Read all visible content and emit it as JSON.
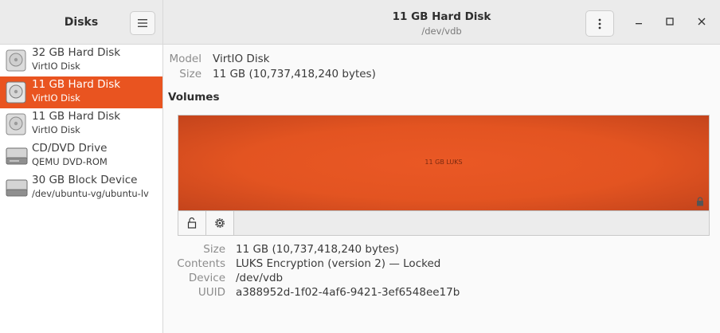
{
  "sidebar": {
    "title": "Disks",
    "items": [
      {
        "name": "32 GB Hard Disk",
        "sub": "VirtIO Disk",
        "icon": "hard-disk-icon",
        "selected": false
      },
      {
        "name": "11 GB Hard Disk",
        "sub": "VirtIO Disk",
        "icon": "hard-disk-icon",
        "selected": true
      },
      {
        "name": "11 GB Hard Disk",
        "sub": "VirtIO Disk",
        "icon": "hard-disk-icon",
        "selected": false
      },
      {
        "name": "CD/DVD Drive",
        "sub": "QEMU DVD-ROM",
        "icon": "optical-drive-icon",
        "selected": false
      },
      {
        "name": "30 GB Block Device",
        "sub": "/dev/ubuntu-vg/ubuntu-lv",
        "icon": "block-device-icon",
        "selected": false
      }
    ]
  },
  "header": {
    "title": "11 GB Hard Disk",
    "subtitle": "/dev/vdb"
  },
  "disk": {
    "model_label": "Model",
    "model_value": "VirtIO Disk",
    "size_label": "Size",
    "size_value": "11 GB (10,737,418,240 bytes)"
  },
  "volumes": {
    "heading": "Volumes",
    "block_label": "11 GB LUKS"
  },
  "partition": {
    "size_label": "Size",
    "size_value": "11 GB (10,737,418,240 bytes)",
    "contents_label": "Contents",
    "contents_value": "LUKS Encryption (version 2) — Locked",
    "device_label": "Device",
    "device_value": "/dev/vdb",
    "uuid_label": "UUID",
    "uuid_value": "a388952d-1f02-4af6-9421-3ef6548ee17b"
  },
  "colors": {
    "accent": "#e95420",
    "sidebar_bg": "#ffffff",
    "header_bg": "#ebebeb"
  }
}
